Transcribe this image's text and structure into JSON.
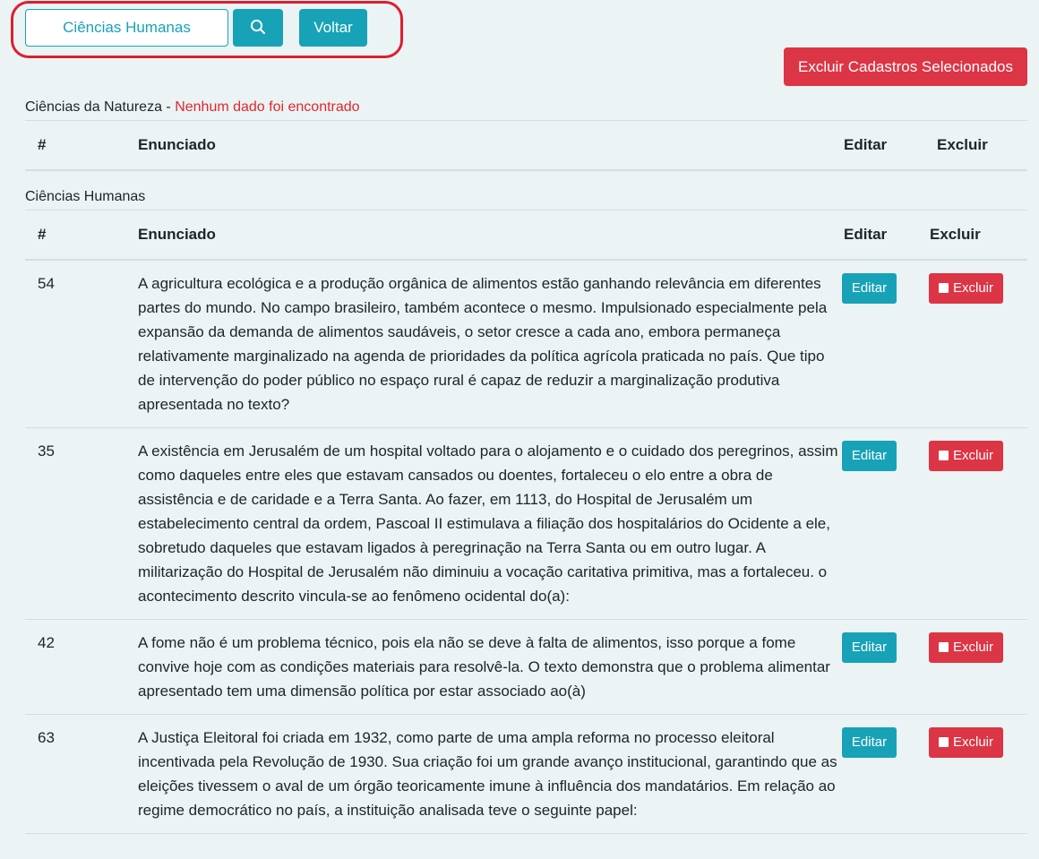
{
  "search": {
    "value": "Ciências Humanas",
    "search_icon": "search-icon",
    "back_label": "Voltar"
  },
  "actions": {
    "delete_selected_label": "Excluir Cadastros Selecionados"
  },
  "sections": [
    {
      "title": "Ciências da Natureza",
      "separator": " - ",
      "message": "Nenhum dado foi encontrado",
      "headers": {
        "num": "#",
        "statement": "Enunciado",
        "edit": "Editar",
        "delete": "Excluir"
      },
      "rows": []
    },
    {
      "title": "Ciências Humanas",
      "headers": {
        "num": "#",
        "statement": "Enunciado",
        "edit": "Editar",
        "delete": "Excluir"
      },
      "rows": [
        {
          "id": "54",
          "text": "A agricultura ecológica e a produção orgânica de alimentos estão ganhando relevância em diferentes partes do mundo. No campo brasileiro, também acontece o mesmo. Impulsionado especialmente pela expansão da demanda de alimentos saudáveis, o setor cresce a cada ano, embora permaneça relativamente marginalizado na agenda de prioridades da política agrícola praticada no país. Que tipo de intervenção do poder público no espaço rural é capaz de reduzir a marginalização produtiva apresentada no texto?",
          "edit_label": "Editar",
          "delete_label": "Excluir"
        },
        {
          "id": "35",
          "text": "A existência em Jerusalém de um hospital voltado para o alojamento e o cuidado dos peregrinos, assim como daqueles entre eles que estavam cansados ou doentes, fortaleceu o elo entre a obra de assistência e de caridade e a Terra Santa. Ao fazer, em 1113, do Hospital de Jerusalém um estabelecimento central da ordem, Pascoal II estimulava a filiação dos hospitalários do Ocidente a ele, sobretudo daqueles que estavam ligados à peregrinação na Terra Santa ou em outro lugar. A militarização do Hospital de Jerusalém não diminuiu a vocação caritativa primitiva, mas a fortaleceu. o acontecimento descrito vincula-se ao fenômeno ocidental do(a):",
          "edit_label": "Editar",
          "delete_label": "Excluir"
        },
        {
          "id": "42",
          "text": "A fome não é um problema técnico, pois ela não se deve à falta de alimentos, isso porque a fome convive hoje com as condições materiais para resolvê-la.  O texto demonstra que o problema alimentar apresentado tem uma dimensão política por estar associado ao(à)",
          "edit_label": "Editar",
          "delete_label": "Excluir"
        },
        {
          "id": "63",
          "text": "A Justiça Eleitoral foi criada em 1932, como parte de uma ampla reforma no processo eleitoral incentivada pela Revolução de 1930. Sua criação foi um grande avanço institucional, garantindo que as eleições tivessem o aval de um órgão teoricamente imune à influência dos mandatários. Em relação ao regime democrático no país, a instituição analisada teve o seguinte papel:",
          "edit_label": "Editar",
          "delete_label": "Excluir"
        }
      ]
    }
  ],
  "colors": {
    "background": "#ecf3f4",
    "info": "#17a2b8",
    "danger": "#dc3545",
    "error_text": "#e3262e",
    "highlight_outline": "#dc1f2e"
  }
}
